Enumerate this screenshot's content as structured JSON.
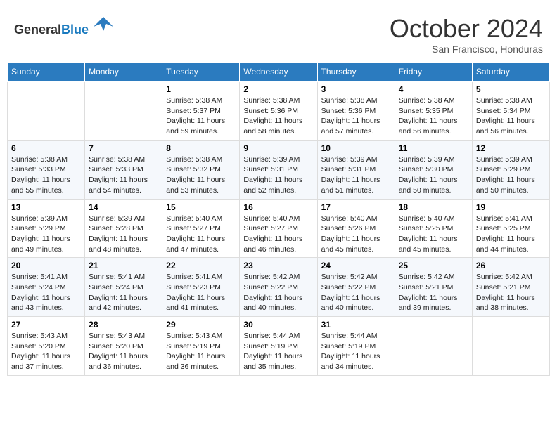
{
  "header": {
    "logo_general": "General",
    "logo_blue": "Blue",
    "month_title": "October 2024",
    "location": "San Francisco, Honduras"
  },
  "weekdays": [
    "Sunday",
    "Monday",
    "Tuesday",
    "Wednesday",
    "Thursday",
    "Friday",
    "Saturday"
  ],
  "weeks": [
    [
      {
        "day": "",
        "content": ""
      },
      {
        "day": "",
        "content": ""
      },
      {
        "day": "1",
        "content": "Sunrise: 5:38 AM\nSunset: 5:37 PM\nDaylight: 11 hours and 59 minutes."
      },
      {
        "day": "2",
        "content": "Sunrise: 5:38 AM\nSunset: 5:36 PM\nDaylight: 11 hours and 58 minutes."
      },
      {
        "day": "3",
        "content": "Sunrise: 5:38 AM\nSunset: 5:36 PM\nDaylight: 11 hours and 57 minutes."
      },
      {
        "day": "4",
        "content": "Sunrise: 5:38 AM\nSunset: 5:35 PM\nDaylight: 11 hours and 56 minutes."
      },
      {
        "day": "5",
        "content": "Sunrise: 5:38 AM\nSunset: 5:34 PM\nDaylight: 11 hours and 56 minutes."
      }
    ],
    [
      {
        "day": "6",
        "content": "Sunrise: 5:38 AM\nSunset: 5:33 PM\nDaylight: 11 hours and 55 minutes."
      },
      {
        "day": "7",
        "content": "Sunrise: 5:38 AM\nSunset: 5:33 PM\nDaylight: 11 hours and 54 minutes."
      },
      {
        "day": "8",
        "content": "Sunrise: 5:38 AM\nSunset: 5:32 PM\nDaylight: 11 hours and 53 minutes."
      },
      {
        "day": "9",
        "content": "Sunrise: 5:39 AM\nSunset: 5:31 PM\nDaylight: 11 hours and 52 minutes."
      },
      {
        "day": "10",
        "content": "Sunrise: 5:39 AM\nSunset: 5:31 PM\nDaylight: 11 hours and 51 minutes."
      },
      {
        "day": "11",
        "content": "Sunrise: 5:39 AM\nSunset: 5:30 PM\nDaylight: 11 hours and 50 minutes."
      },
      {
        "day": "12",
        "content": "Sunrise: 5:39 AM\nSunset: 5:29 PM\nDaylight: 11 hours and 50 minutes."
      }
    ],
    [
      {
        "day": "13",
        "content": "Sunrise: 5:39 AM\nSunset: 5:29 PM\nDaylight: 11 hours and 49 minutes."
      },
      {
        "day": "14",
        "content": "Sunrise: 5:39 AM\nSunset: 5:28 PM\nDaylight: 11 hours and 48 minutes."
      },
      {
        "day": "15",
        "content": "Sunrise: 5:40 AM\nSunset: 5:27 PM\nDaylight: 11 hours and 47 minutes."
      },
      {
        "day": "16",
        "content": "Sunrise: 5:40 AM\nSunset: 5:27 PM\nDaylight: 11 hours and 46 minutes."
      },
      {
        "day": "17",
        "content": "Sunrise: 5:40 AM\nSunset: 5:26 PM\nDaylight: 11 hours and 45 minutes."
      },
      {
        "day": "18",
        "content": "Sunrise: 5:40 AM\nSunset: 5:25 PM\nDaylight: 11 hours and 45 minutes."
      },
      {
        "day": "19",
        "content": "Sunrise: 5:41 AM\nSunset: 5:25 PM\nDaylight: 11 hours and 44 minutes."
      }
    ],
    [
      {
        "day": "20",
        "content": "Sunrise: 5:41 AM\nSunset: 5:24 PM\nDaylight: 11 hours and 43 minutes."
      },
      {
        "day": "21",
        "content": "Sunrise: 5:41 AM\nSunset: 5:24 PM\nDaylight: 11 hours and 42 minutes."
      },
      {
        "day": "22",
        "content": "Sunrise: 5:41 AM\nSunset: 5:23 PM\nDaylight: 11 hours and 41 minutes."
      },
      {
        "day": "23",
        "content": "Sunrise: 5:42 AM\nSunset: 5:22 PM\nDaylight: 11 hours and 40 minutes."
      },
      {
        "day": "24",
        "content": "Sunrise: 5:42 AM\nSunset: 5:22 PM\nDaylight: 11 hours and 40 minutes."
      },
      {
        "day": "25",
        "content": "Sunrise: 5:42 AM\nSunset: 5:21 PM\nDaylight: 11 hours and 39 minutes."
      },
      {
        "day": "26",
        "content": "Sunrise: 5:42 AM\nSunset: 5:21 PM\nDaylight: 11 hours and 38 minutes."
      }
    ],
    [
      {
        "day": "27",
        "content": "Sunrise: 5:43 AM\nSunset: 5:20 PM\nDaylight: 11 hours and 37 minutes."
      },
      {
        "day": "28",
        "content": "Sunrise: 5:43 AM\nSunset: 5:20 PM\nDaylight: 11 hours and 36 minutes."
      },
      {
        "day": "29",
        "content": "Sunrise: 5:43 AM\nSunset: 5:19 PM\nDaylight: 11 hours and 36 minutes."
      },
      {
        "day": "30",
        "content": "Sunrise: 5:44 AM\nSunset: 5:19 PM\nDaylight: 11 hours and 35 minutes."
      },
      {
        "day": "31",
        "content": "Sunrise: 5:44 AM\nSunset: 5:19 PM\nDaylight: 11 hours and 34 minutes."
      },
      {
        "day": "",
        "content": ""
      },
      {
        "day": "",
        "content": ""
      }
    ]
  ]
}
